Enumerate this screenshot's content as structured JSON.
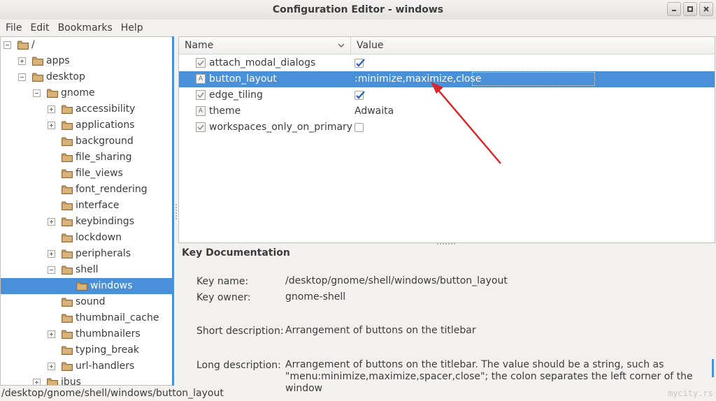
{
  "window": {
    "title": "Configuration Editor - windows",
    "controls": [
      "minimize",
      "maximize",
      "close"
    ]
  },
  "menubar": [
    "File",
    "Edit",
    "Bookmarks",
    "Help"
  ],
  "tree": {
    "nodes": [
      {
        "label": "/",
        "level": 0,
        "expander": "minus"
      },
      {
        "label": "apps",
        "level": 1,
        "expander": "plus"
      },
      {
        "label": "desktop",
        "level": 1,
        "expander": "minus"
      },
      {
        "label": "gnome",
        "level": 2,
        "expander": "minus"
      },
      {
        "label": "accessibility",
        "level": 3,
        "expander": "plus"
      },
      {
        "label": "applications",
        "level": 3,
        "expander": "plus"
      },
      {
        "label": "background",
        "level": 3,
        "expander": "none"
      },
      {
        "label": "file_sharing",
        "level": 3,
        "expander": "none"
      },
      {
        "label": "file_views",
        "level": 3,
        "expander": "none"
      },
      {
        "label": "font_rendering",
        "level": 3,
        "expander": "none"
      },
      {
        "label": "interface",
        "level": 3,
        "expander": "none"
      },
      {
        "label": "keybindings",
        "level": 3,
        "expander": "plus"
      },
      {
        "label": "lockdown",
        "level": 3,
        "expander": "none"
      },
      {
        "label": "peripherals",
        "level": 3,
        "expander": "plus"
      },
      {
        "label": "shell",
        "level": 3,
        "expander": "minus"
      },
      {
        "label": "windows",
        "level": 4,
        "expander": "none",
        "selected": true
      },
      {
        "label": "sound",
        "level": 3,
        "expander": "none"
      },
      {
        "label": "thumbnail_cache",
        "level": 3,
        "expander": "none"
      },
      {
        "label": "thumbnailers",
        "level": 3,
        "expander": "plus"
      },
      {
        "label": "typing_break",
        "level": 3,
        "expander": "none"
      },
      {
        "label": "url-handlers",
        "level": 3,
        "expander": "plus"
      },
      {
        "label": "ibus",
        "level": 2,
        "expander": "plus"
      }
    ]
  },
  "keys": {
    "columns": {
      "name": "Name",
      "value": "Value"
    },
    "rows": [
      {
        "name": "attach_modal_dialogs",
        "type": "bool",
        "checked": true
      },
      {
        "name": "button_layout",
        "type": "string",
        "value": ":minimize,maximize,close",
        "selected": true,
        "editing": true
      },
      {
        "name": "edge_tiling",
        "type": "bool",
        "checked": true
      },
      {
        "name": "theme",
        "type": "string",
        "value": "Adwaita"
      },
      {
        "name": "workspaces_only_on_primary",
        "type": "bool",
        "checked": false
      }
    ]
  },
  "doc": {
    "title": "Key Documentation",
    "key_name_label": "Key name:",
    "key_name": "/desktop/gnome/shell/windows/button_layout",
    "key_owner_label": "Key owner:",
    "key_owner": "gnome-shell",
    "short_label": "Short description:",
    "short": "Arrangement of buttons on the titlebar",
    "long_label": "Long description:",
    "long_1": "Arrangement of buttons on the titlebar. The value should be a string, such as",
    "long_2": "\"menu:minimize,maximize,spacer,close\"; the colon separates the left corner of the window"
  },
  "status": "/desktop/gnome/shell/windows/button_layout",
  "watermark": "mycity.rs",
  "colors": {
    "selection": "#4a90d9",
    "arrow": "#d9262b"
  }
}
